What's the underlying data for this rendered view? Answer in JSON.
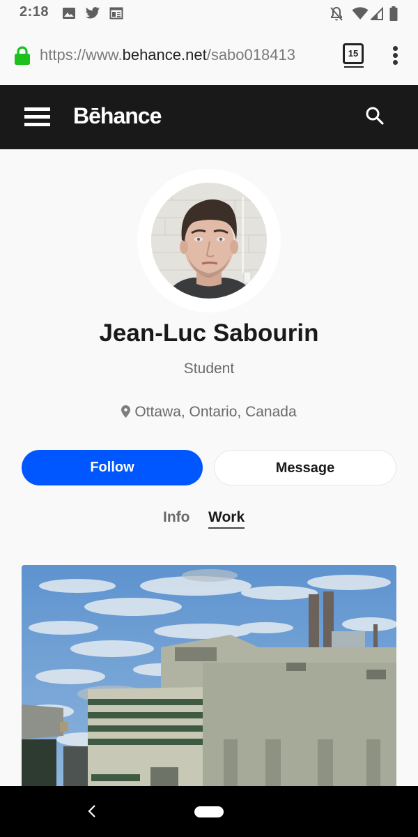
{
  "status_bar": {
    "time": "2:18",
    "left_icons": [
      "image-icon",
      "twitter-icon",
      "news-icon"
    ],
    "right_icons": [
      "notifications-off-icon",
      "wifi-icon",
      "signal-icon",
      "battery-icon"
    ]
  },
  "browser": {
    "url_prefix": "https://www.",
    "url_domain": "behance.net",
    "url_path": "/sabo018413",
    "tab_count": "15",
    "lock_color": "#1ec01e"
  },
  "header": {
    "logo": "Bēhance",
    "menu_icon": "hamburger-icon",
    "search_icon": "search-icon"
  },
  "profile": {
    "name": "Jean-Luc Sabourin",
    "occupation": "Student",
    "location": "Ottawa, Ontario, Canada",
    "follow_label": "Follow",
    "message_label": "Message",
    "accent_color": "#0057ff"
  },
  "tabs": [
    {
      "label": "Info",
      "active": false
    },
    {
      "label": "Work",
      "active": true
    }
  ],
  "projects": [
    {
      "description": "Painting of industrial buildings under a cloudy blue sky"
    }
  ],
  "nav_bar": {
    "back_icon": "back-icon",
    "home_icon": "home-pill-icon"
  }
}
